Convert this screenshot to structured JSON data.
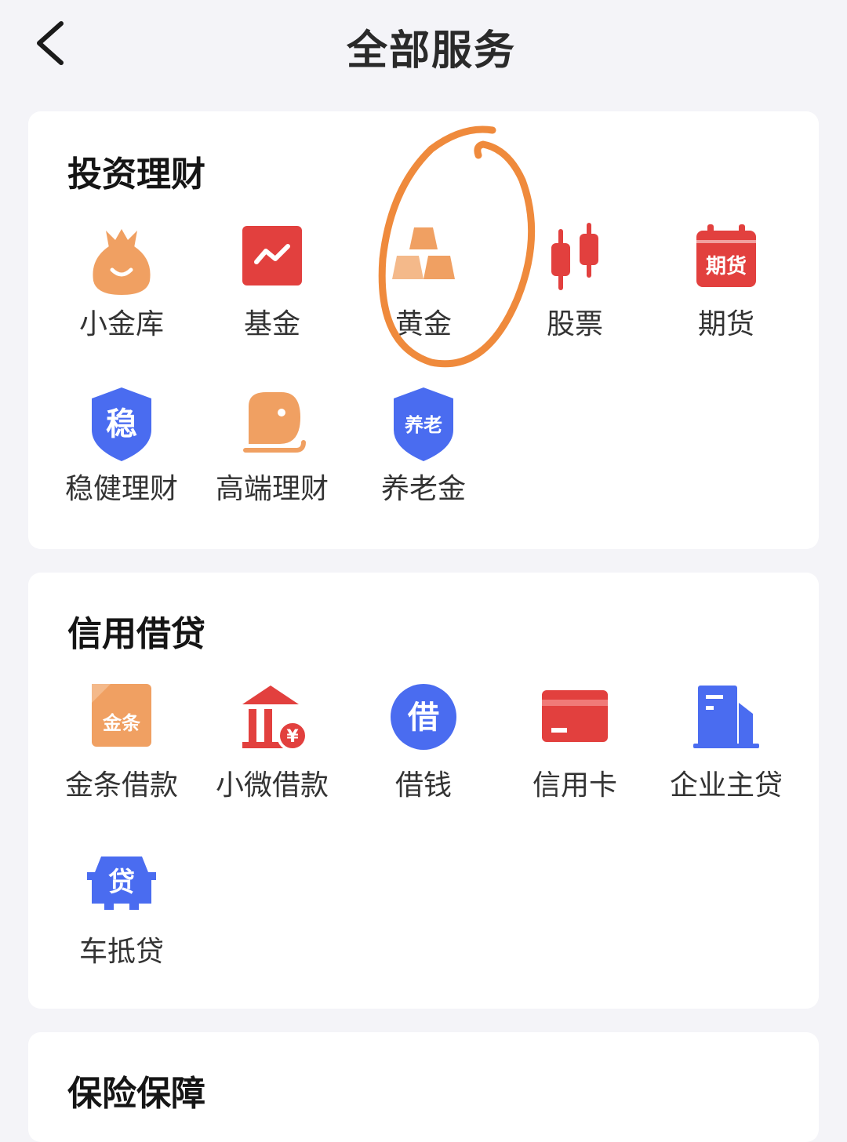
{
  "header": {
    "title": "全部服务",
    "back_icon": "chevron-left-icon"
  },
  "sections": [
    {
      "title": "投资理财",
      "items": [
        {
          "label": "小金库",
          "icon": "money-bag-icon"
        },
        {
          "label": "基金",
          "icon": "fund-chart-icon"
        },
        {
          "label": "黄金",
          "icon": "gold-bars-icon"
        },
        {
          "label": "股票",
          "icon": "candlestick-icon"
        },
        {
          "label": "期货",
          "icon": "futures-calendar-icon",
          "icon_text": "期货"
        },
        {
          "label": "稳健理财",
          "icon": "steady-shield-icon",
          "icon_text": "稳"
        },
        {
          "label": "高端理财",
          "icon": "premium-wallet-icon"
        },
        {
          "label": "养老金",
          "icon": "pension-shield-icon",
          "icon_text": "养老"
        }
      ]
    },
    {
      "title": "信用借贷",
      "items": [
        {
          "label": "金条借款",
          "icon": "gold-strip-icon",
          "icon_text": "金条"
        },
        {
          "label": "小微借款",
          "icon": "bank-yuan-icon",
          "icon_text": "¥"
        },
        {
          "label": "借钱",
          "icon": "borrow-circle-icon",
          "icon_text": "借"
        },
        {
          "label": "信用卡",
          "icon": "credit-card-icon"
        },
        {
          "label": "企业主贷",
          "icon": "building-icon"
        },
        {
          "label": "车抵贷",
          "icon": "car-loan-icon",
          "icon_text": "贷"
        }
      ]
    },
    {
      "title": "保险保障",
      "items": []
    }
  ],
  "colors": {
    "background": "#f4f4f8",
    "card": "#ffffff",
    "orange": "#f0a062",
    "red": "#e2403e",
    "blue": "#4a6cf0",
    "annotation": "#ef8a3c"
  }
}
